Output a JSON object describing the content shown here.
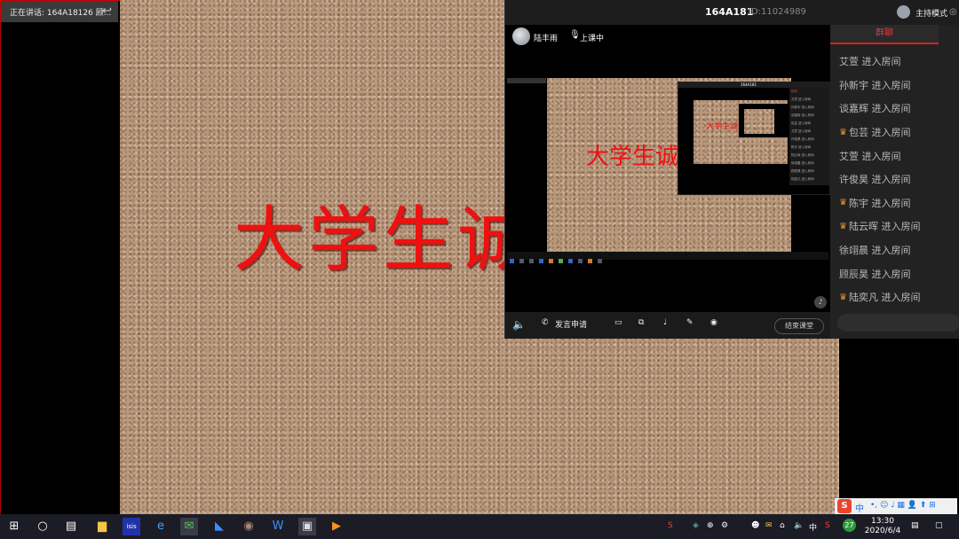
{
  "speaker_bar": {
    "label": "正在讲话: 164A18126 顾..."
  },
  "main_slide": {
    "text": "大学生诚"
  },
  "class_window": {
    "room_name": "164A181",
    "room_id": "ID:11024989",
    "mode_label": "主持模式",
    "teacher_name": "陆丰雨",
    "live_status": "上课中"
  },
  "mirror": {
    "slide_text": "大学生诚",
    "chat_header": "群聊",
    "chat_rows": [
      "艾萱 进入房间",
      "孙新宇 进入房间",
      "谈嘉辉 进入房间",
      "包芸 进入房间",
      "艾萱 进入房间",
      "许俊昊 进入房间",
      "陈宇 进入房间",
      "陆云晖 进入房间",
      "徐翊晨 进入房间",
      "顾辰昊 进入房间",
      "陆奕凡 进入房间"
    ]
  },
  "controls": {
    "speak_request": "发言申请",
    "end_class": "结束课堂"
  },
  "chat": {
    "tab": "群聊",
    "messages": [
      {
        "name": "艾萱",
        "text": "艾萱 进入房间",
        "badge": false
      },
      {
        "name": "孙新宇",
        "text": "孙新宇 进入房间",
        "badge": false
      },
      {
        "name": "谈嘉辉",
        "text": "谈嘉辉 进入房间",
        "badge": false
      },
      {
        "name": "包芸",
        "text": "包芸 进入房间",
        "badge": true
      },
      {
        "name": "艾萱",
        "text": "艾萱 进入房间",
        "badge": false
      },
      {
        "name": "许俊昊",
        "text": "许俊昊 进入房间",
        "badge": false
      },
      {
        "name": "陈宇",
        "text": "陈宇 进入房间",
        "badge": true
      },
      {
        "name": "陆云晖",
        "text": "陆云晖 进入房间",
        "badge": true
      },
      {
        "name": "徐翊晨",
        "text": "徐翊晨 进入房间",
        "badge": false
      },
      {
        "name": "顾辰昊",
        "text": "顾辰昊 进入房间",
        "badge": false
      },
      {
        "name": "陆奕凡",
        "text": "陆奕凡 进入房间",
        "badge": true
      }
    ]
  },
  "taskbar": {
    "ime_lang": "中",
    "tray_lang": "中",
    "time": "13:30",
    "date": "2020/6/4",
    "badge_count": "27"
  },
  "colors": {
    "accent": "#dd2222",
    "slide_text": "#ee1111",
    "badge": "#e59430"
  }
}
